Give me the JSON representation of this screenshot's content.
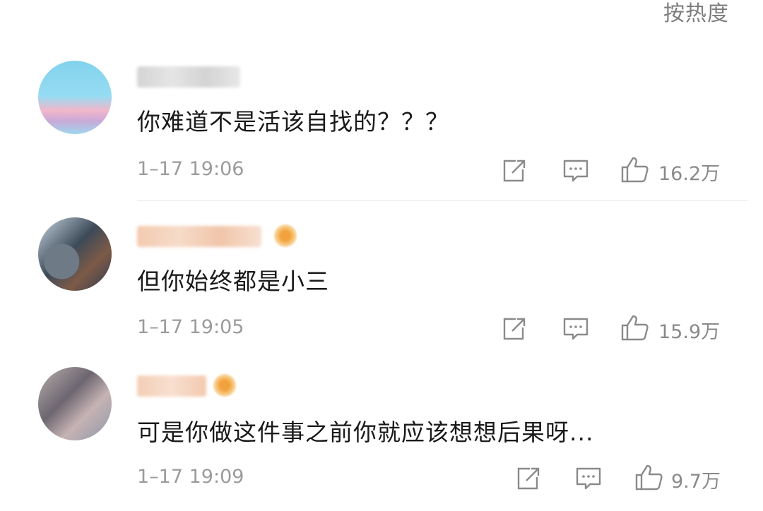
{
  "header": {
    "sort_label": "按热度"
  },
  "comments": [
    {
      "content": "你难道不是活该自找的？？？",
      "time": "1–17 19:06",
      "likes": "16.2万"
    },
    {
      "content": "但你始终都是小三",
      "time": "1–17 19:05",
      "likes": "15.9万"
    },
    {
      "content": "可是你做这件事之前你就应该想想后果呀...",
      "time": "1–17 19:09",
      "likes": "9.7万"
    }
  ],
  "icons": {
    "share": "share-icon",
    "reply": "comment-icon",
    "like": "thumbs-up-icon"
  }
}
